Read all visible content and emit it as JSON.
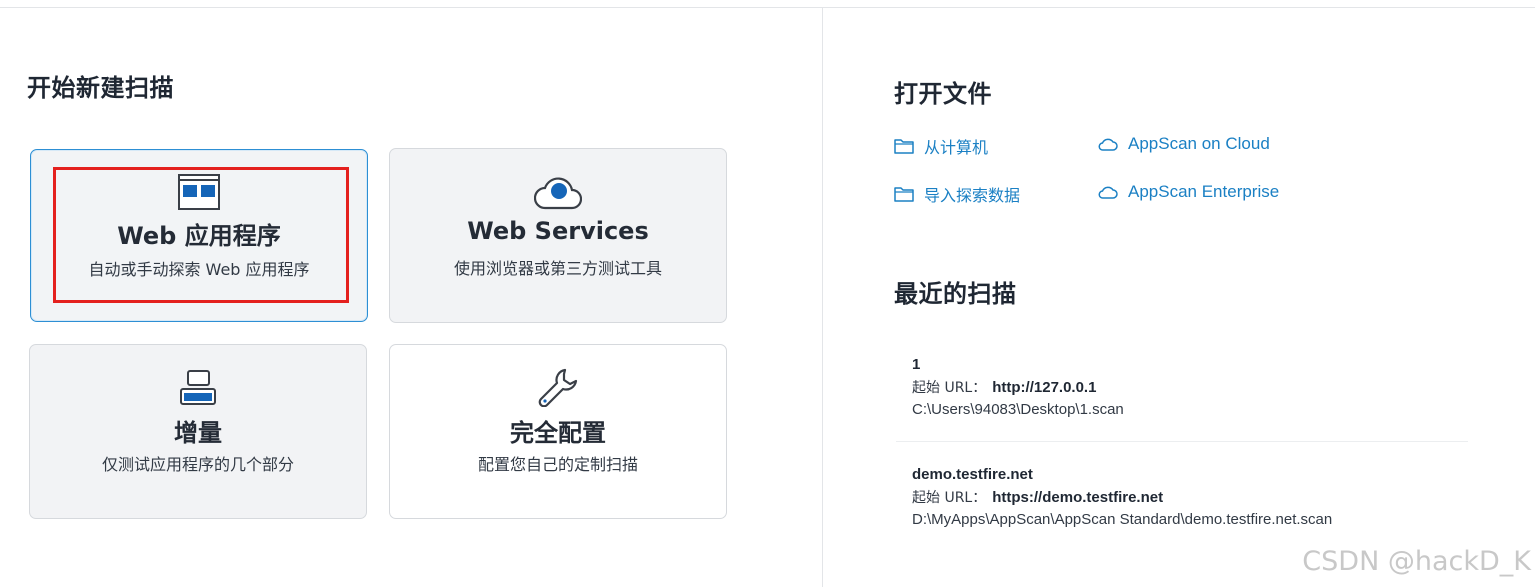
{
  "new_scan": {
    "title": "开始新建扫描",
    "cards": [
      {
        "title": "Web 应用程序",
        "subtitle": "自动或手动探索 Web 应用程序",
        "icon": "web-app-window-icon"
      },
      {
        "title": "Web Services",
        "subtitle": "使用浏览器或第三方测试工具",
        "icon": "web-services-cloud-icon"
      },
      {
        "title": "增量",
        "subtitle": "仅测试应用程序的几个部分",
        "icon": "incremental-icon"
      },
      {
        "title": "完全配置",
        "subtitle": "配置您自己的定制扫描",
        "icon": "wrench-icon"
      }
    ]
  },
  "open_file": {
    "title": "打开文件",
    "links": {
      "computer": "从计算机",
      "import": "导入探索数据",
      "cloud": "AppScan on Cloud",
      "enterprise": "AppScan Enterprise"
    }
  },
  "recent": {
    "title": "最近的扫描",
    "url_label": "起始 URL：",
    "items": [
      {
        "name": "1",
        "url": "http://127.0.0.1",
        "path": "C:\\Users\\94083\\Desktop\\1.scan"
      },
      {
        "name": "demo.testfire.net",
        "url": "https://demo.testfire.net",
        "path": "D:\\MyApps\\AppScan\\AppScan Standard\\demo.testfire.net.scan"
      }
    ]
  },
  "watermark": "CSDN @hackD_K",
  "colors": {
    "accent": "#1b80c4",
    "selected_border": "#2d8fd4",
    "highlight": "#e4201e",
    "icon_blue": "#1565b8"
  }
}
